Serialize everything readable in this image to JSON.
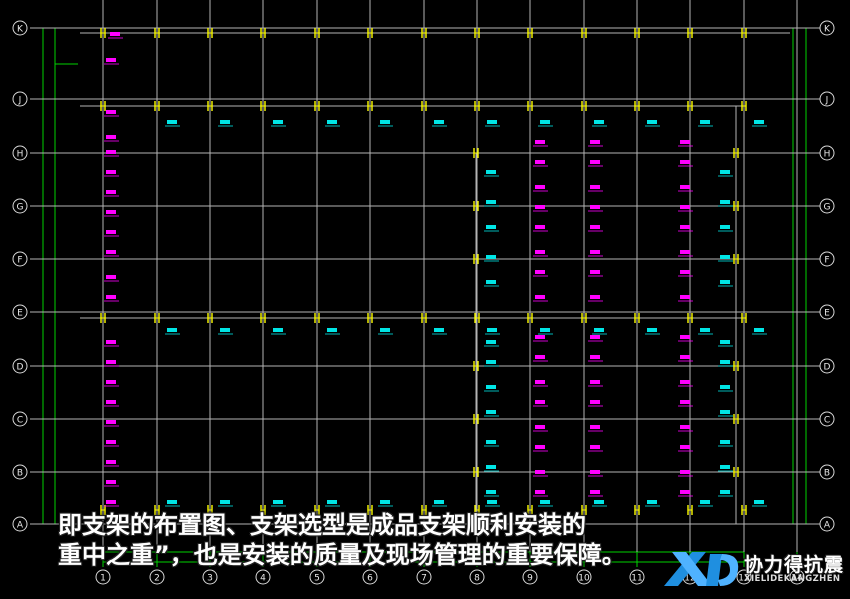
{
  "drawing": {
    "row_axes": [
      "K",
      "J",
      "H",
      "G",
      "F",
      "E",
      "D",
      "C",
      "B",
      "A"
    ],
    "column_axes": [
      "1",
      "2",
      "3",
      "4",
      "5",
      "6",
      "7",
      "8",
      "9",
      "10",
      "11",
      "12",
      "13",
      "14"
    ],
    "colors": {
      "background": "#000000",
      "grid_line": "#b4b4b4",
      "dimension_line": "#00d200",
      "support_tag": "#ff00ff",
      "support_tag_alt": "#00e5e5",
      "support_mark": "#ffff00"
    }
  },
  "caption": {
    "line1": "即支架的布置图、支架选型是成品支架顺利安装的",
    "line2": "重中之重”，也是安装的质量及现场管理的重要保障。"
  },
  "logo": {
    "name": "协力得抗震",
    "sub": "XIELIDEKANGZHEN",
    "mark_text": "XLD"
  }
}
